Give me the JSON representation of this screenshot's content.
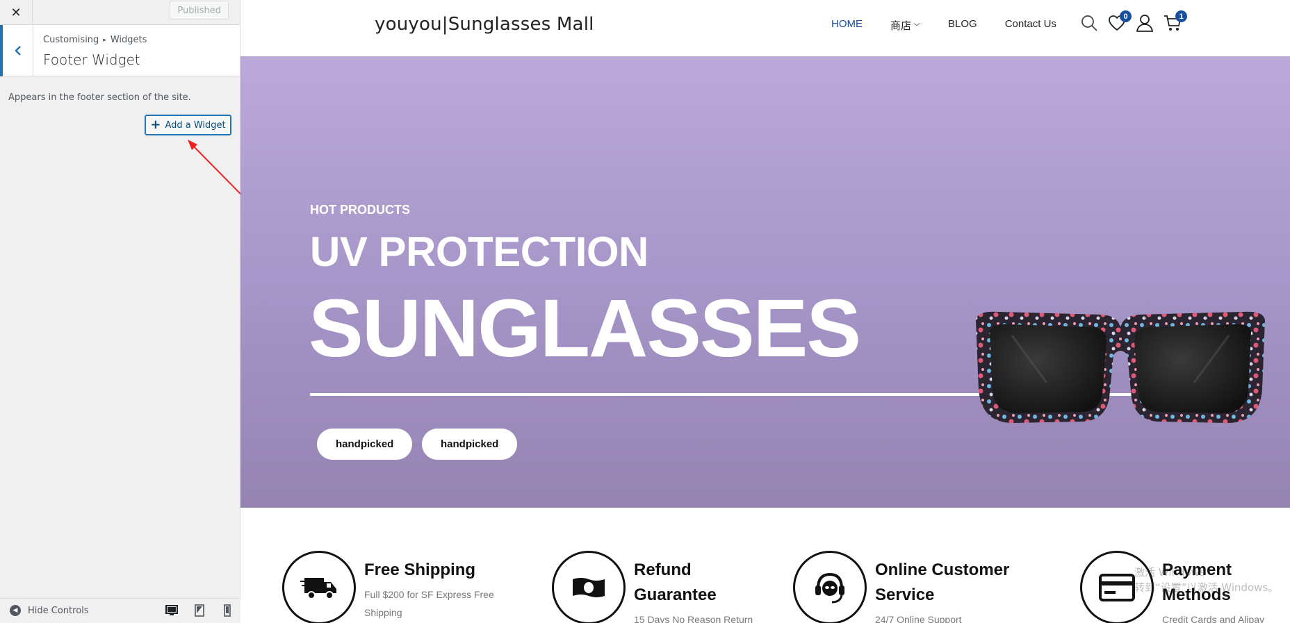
{
  "customizer": {
    "close_label": "✕",
    "published_label": "Published",
    "breadcrumb": {
      "root": "Customising",
      "separator": "▸",
      "parent": "Widgets"
    },
    "section_title": "Footer Widget",
    "description": "Appears in the footer section of the site.",
    "add_widget_label": "Add a Widget",
    "hide_controls_label": "Hide Controls",
    "devices": [
      "desktop-icon",
      "tablet-icon",
      "mobile-icon"
    ],
    "accent_color": "#2271b1",
    "annotation_color": "#ee2222"
  },
  "site": {
    "logo": "youyou|Sunglasses Mall",
    "nav": [
      {
        "label": "HOME",
        "active": true
      },
      {
        "label": "商店",
        "dropdown": true
      },
      {
        "label": "BLOG"
      },
      {
        "label": "Contact Us"
      }
    ],
    "wishlist_count": "0",
    "cart_count": "1",
    "hero": {
      "kicker": "HOT PRODUCTS",
      "line1": "UV PROTECTION",
      "line2": "SUNGLASSES",
      "buttons": [
        "handpicked",
        "handpicked"
      ],
      "bg_color": "#a696c9"
    },
    "features": [
      {
        "icon": "truck-icon",
        "title": "Free Shipping",
        "desc": "Full $200 for SF Express Free Shipping"
      },
      {
        "icon": "cash-icon",
        "title": "Refund Guarantee",
        "desc": "15 Days No Reason Return"
      },
      {
        "icon": "headset-icon",
        "title": "Online Customer Service",
        "desc": "24/7 Online Support"
      },
      {
        "icon": "credit-card-icon",
        "title": "Payment Methods",
        "desc": "Credit Cards and Alipay"
      }
    ]
  },
  "watermark": {
    "line1": "激活 Windows",
    "line2": "转到“设置”以激活 Windows。"
  }
}
